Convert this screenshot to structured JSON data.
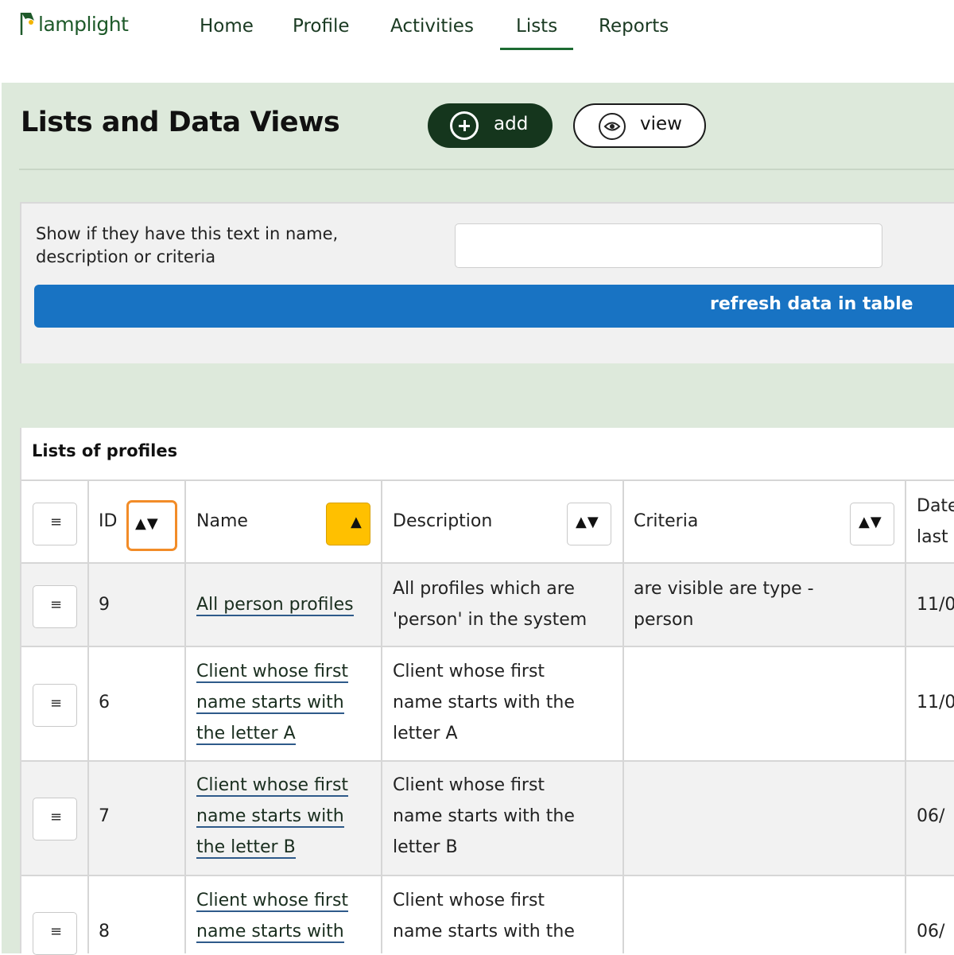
{
  "app": {
    "logo_text": "lamplight"
  },
  "nav": {
    "items": [
      "Home",
      "Profile",
      "Activities",
      "Lists",
      "Reports"
    ],
    "active": "Lists"
  },
  "page": {
    "title": "Lists and Data Views",
    "add_label": "add",
    "view_label": "view"
  },
  "filter": {
    "label": "Show if they have this text in name, description or criteria",
    "value": "",
    "refresh_label": "refresh data in table"
  },
  "table": {
    "caption": "Lists of profiles",
    "headers": {
      "menu": "≡",
      "id": "ID",
      "name": "Name",
      "description": "Description",
      "criteria": "Criteria",
      "date_line1": "Date",
      "date_line2": "last"
    },
    "sort_icons": {
      "both": "▲▼",
      "asc": "▲"
    },
    "rows": [
      {
        "menu": "≡",
        "id": "9",
        "name": [
          "All person profiles"
        ],
        "description": [
          "All profiles which are",
          "'person' in the system"
        ],
        "criteria": [
          "are visible are type -",
          "person"
        ],
        "date": "11/0"
      },
      {
        "menu": "≡",
        "id": "6",
        "name": [
          "Client whose first",
          "name starts with",
          "the letter A"
        ],
        "description": [
          "Client whose first",
          "name starts with the",
          "letter A"
        ],
        "criteria": [],
        "date": "11/0"
      },
      {
        "menu": "≡",
        "id": "7",
        "name": [
          "Client whose first",
          "name starts with",
          "the letter B"
        ],
        "description": [
          "Client whose first",
          "name starts with the",
          "letter B"
        ],
        "criteria": [],
        "date": "06/"
      },
      {
        "menu": "≡",
        "id": "8",
        "name": [
          "Client whose first",
          "name starts with"
        ],
        "description": [
          "Client whose first",
          "name starts with the"
        ],
        "criteria": [],
        "date": "06/"
      }
    ]
  }
}
